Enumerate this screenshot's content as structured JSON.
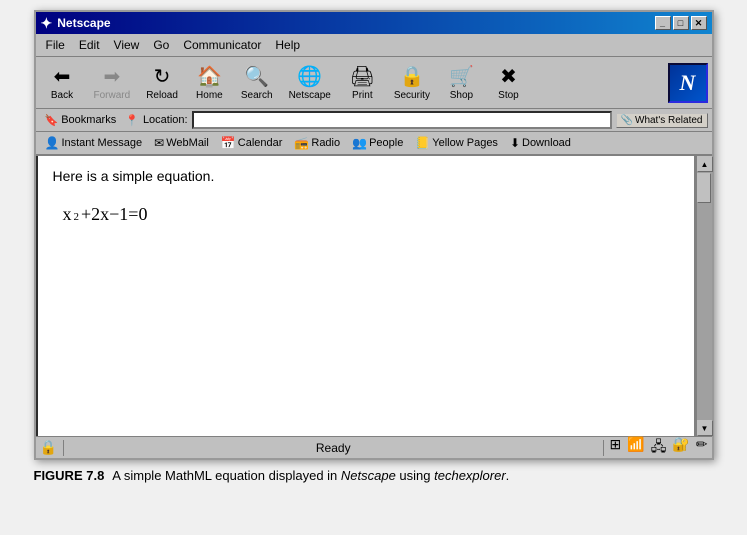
{
  "window": {
    "title": "Netscape",
    "title_icon": "✦"
  },
  "title_controls": {
    "minimize": "_",
    "maximize": "□",
    "close": "✕"
  },
  "menu": {
    "items": [
      "File",
      "Edit",
      "View",
      "Go",
      "Communicator",
      "Help"
    ]
  },
  "toolbar": {
    "buttons": [
      {
        "id": "back",
        "label": "Back",
        "icon": "⬅",
        "disabled": false
      },
      {
        "id": "forward",
        "label": "Forward",
        "icon": "➡",
        "disabled": true
      },
      {
        "id": "reload",
        "label": "Reload",
        "icon": "↻",
        "disabled": false
      },
      {
        "id": "home",
        "label": "Home",
        "icon": "🏠",
        "disabled": false
      },
      {
        "id": "search",
        "label": "Search",
        "icon": "🔍",
        "disabled": false
      },
      {
        "id": "netscape",
        "label": "Netscape",
        "icon": "🌐",
        "disabled": false
      },
      {
        "id": "print",
        "label": "Print",
        "icon": "🖨",
        "disabled": false
      },
      {
        "id": "security",
        "label": "Security",
        "icon": "🔒",
        "disabled": false
      },
      {
        "id": "shop",
        "label": "Shop",
        "icon": "🛒",
        "disabled": false
      },
      {
        "id": "stop",
        "label": "Stop",
        "icon": "✖",
        "disabled": false
      }
    ],
    "logo": "N"
  },
  "location_bar": {
    "bookmarks_label": "Bookmarks",
    "location_label": "Location:",
    "location_value": "",
    "whats_related_label": "What's Related"
  },
  "personal_toolbar": {
    "buttons": [
      {
        "id": "instant-message",
        "label": "Instant Message",
        "icon": "👤"
      },
      {
        "id": "webmail",
        "label": "WebMail",
        "icon": "✉"
      },
      {
        "id": "calendar",
        "label": "Calendar",
        "icon": "📅"
      },
      {
        "id": "radio",
        "label": "Radio",
        "icon": "📻"
      },
      {
        "id": "people",
        "label": "People",
        "icon": "👥"
      },
      {
        "id": "yellow-pages",
        "label": "Yellow Pages",
        "icon": "📒"
      },
      {
        "id": "download",
        "label": "Download",
        "icon": "⬇"
      }
    ]
  },
  "content": {
    "intro_text": "Here is a simple equation.",
    "equation": {
      "parts": [
        "x",
        "2",
        "+2x−1=0"
      ]
    }
  },
  "status_bar": {
    "status_text": "Ready",
    "lock_icon": "🔒"
  },
  "figure_caption": {
    "label": "FIGURE 7.8",
    "description": "A simple MathML equation displayed in Netscape using techexplorer."
  }
}
